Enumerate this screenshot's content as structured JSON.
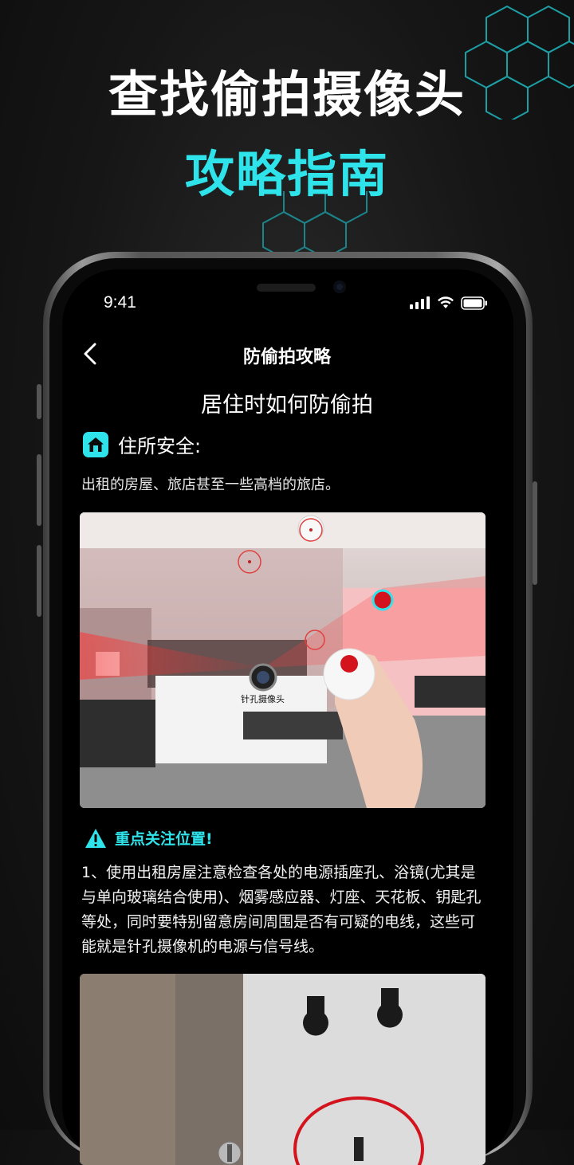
{
  "promo": {
    "title_line1": "查找偷拍摄像头",
    "title_line2": "攻略指南"
  },
  "status_bar": {
    "time": "9:41"
  },
  "nav": {
    "back_icon": "chevron-left-icon",
    "title": "防偷拍攻略"
  },
  "article": {
    "title": "居住时如何防偷拍",
    "section": {
      "icon": "home-icon",
      "label": "住所安全:"
    },
    "description": "出租的房屋、旅店甚至一些高档的旅店。",
    "image1_label": "针孔摄像头",
    "warning": {
      "icon": "warning-triangle-icon",
      "label": "重点关注位置!"
    },
    "body": "1、使用出租房屋注意检查各处的电源插座孔、浴镜(尤其是与单向玻璃结合使用)、烟雾感应器、灯座、天花板、钥匙孔等处，同时要特别留意房间周围是否有可疑的电线，这些可能就是针孔摄像机的电源与信号线。"
  },
  "colors": {
    "accent": "#2fe3ea",
    "background": "#000000",
    "detect_red": "#d3141e"
  }
}
